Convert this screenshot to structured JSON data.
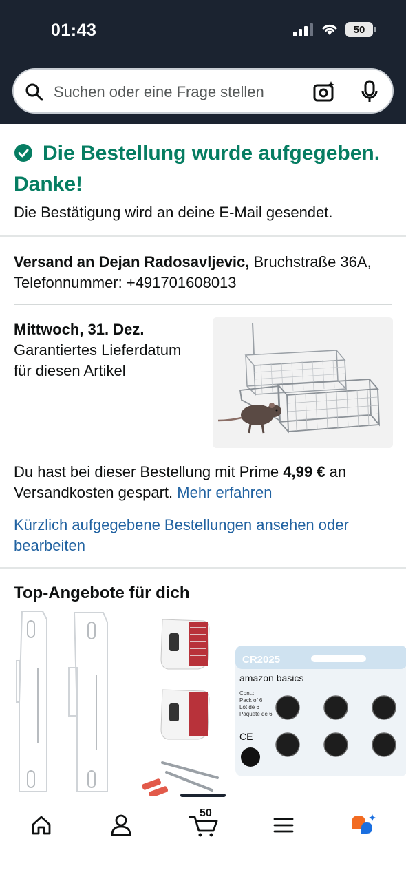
{
  "status_bar": {
    "time": "01:43",
    "battery": "50"
  },
  "search": {
    "placeholder": "Suchen oder eine Frage stellen"
  },
  "confirmation": {
    "title": "Die Bestellung wurde aufgegeben. Danke!",
    "email_note": "Die Bestätigung wird an deine E-Mail gesendet."
  },
  "shipping": {
    "recipient_label": "Versand an Dejan Radosavljevic,",
    "address": " Bruchstraße 36A, Telefonnummer: +491701608013"
  },
  "delivery": {
    "date": "Mittwoch, 31. Dez.",
    "note": "Garantiertes Lieferdatum für diesen Artikel"
  },
  "prime": {
    "text_before": "Du hast bei dieser Bestellung mit Prime ",
    "amount": "4,99 €",
    "text_after": " an Versandkosten gespart. ",
    "learn_more": "Mehr erfahren"
  },
  "recent_orders_link": "Kürzlich aufgegebene Bestellungen ansehen oder bearbeiten",
  "deals": {
    "title": "Top-Angebote für dich",
    "battery_pack": {
      "brand": "CR2025",
      "maker": "amazon basics",
      "desc": "Cont.:\nPack of 6\nLot de 6\nPaquete de 6",
      "ce": "CE"
    }
  },
  "bottom_nav": {
    "cart_count": "50"
  },
  "colors": {
    "success": "#067d62",
    "link": "#2162a1",
    "header": "#1b2330"
  }
}
